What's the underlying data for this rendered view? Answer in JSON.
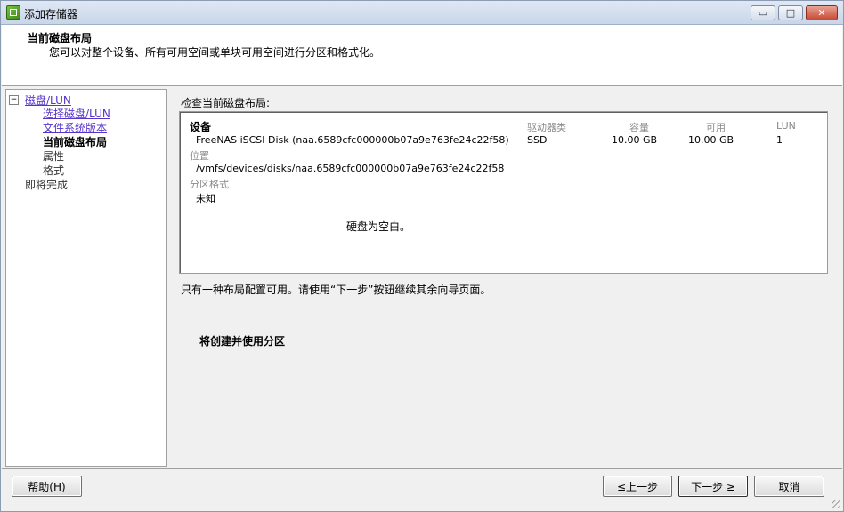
{
  "window": {
    "title": "添加存储器",
    "min_glyph": "▭",
    "max_glyph": "□",
    "close_glyph": "✕"
  },
  "header": {
    "title": "当前磁盘布局",
    "subtitle": "您可以对整个设备、所有可用空间或单块可用空间进行分区和格式化。"
  },
  "nav": {
    "root": {
      "label": "磁盘/LUN",
      "toggle": "−"
    },
    "items": [
      {
        "label": "选择磁盘/LUN",
        "style": "link"
      },
      {
        "label": "文件系统版本",
        "style": "link"
      },
      {
        "label": "当前磁盘布局",
        "style": "current"
      },
      {
        "label": "属性",
        "style": "plain"
      },
      {
        "label": "格式",
        "style": "plain"
      }
    ],
    "finish": "即将完成"
  },
  "content": {
    "section_label": "检查当前磁盘布局:",
    "columns": {
      "device": "设备",
      "drive_type": "驱动器类",
      "capacity": "容量",
      "available": "可用",
      "lun": "LUN"
    },
    "device": {
      "name": "FreeNAS iSCSI Disk (naa.6589cfc000000b07a9e763fe24c22f58)",
      "drive_type": "SSD",
      "capacity": "10.00 GB",
      "available": "10.00 GB",
      "lun": "1"
    },
    "location_label": "位置",
    "location_value": "/vmfs/devices/disks/naa.6589cfc000000b07a9e763fe24c22f58",
    "partition_label": "分区格式",
    "partition_value": "未知",
    "empty_message": "硬盘为空白。",
    "note": "只有一种布局配置可用。请使用“下一步”按钮继续其余向导页面。",
    "create_label": "将创建并使用分区"
  },
  "buttons": {
    "help": "帮助(H)",
    "back": "≤上一步",
    "next": "下一步 ≥",
    "cancel": "取消"
  }
}
